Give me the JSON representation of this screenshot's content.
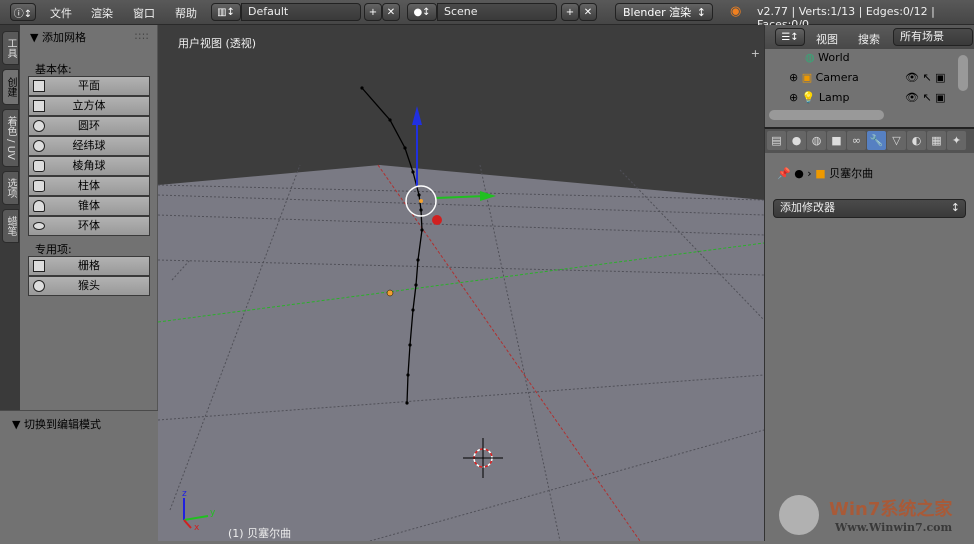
{
  "topbar": {
    "info_icon": "info-icon",
    "menus": [
      "文件",
      "渲染",
      "窗口",
      "帮助"
    ],
    "layout": "Default",
    "scene": "Scene",
    "engine": "Blender 渲染",
    "stats": "v2.77 | Verts:1/13 | Edges:0/12 | Faces:0/0"
  },
  "left_tabs": [
    "工具",
    "创建",
    "着色 / UV",
    "选项",
    "蜡笔"
  ],
  "tool_panel": {
    "title": "▼ 添加网格",
    "basic_label": "基本体:",
    "basic": [
      "平面",
      "立方体",
      "圆环",
      "经纬球",
      "棱角球",
      "柱体",
      "锥体",
      "环体"
    ],
    "special_label": "专用项:",
    "special": [
      "栅格",
      "猴头"
    ]
  },
  "redo_panel": {
    "title": "▼ 切换到编辑模式"
  },
  "viewport": {
    "title": "用户视图 (透视)",
    "object_label": "(1) 贝塞尔曲",
    "axes": {
      "x": "x",
      "y": "y",
      "z": "z"
    },
    "colors": {
      "x": "#d02020",
      "y": "#20c020",
      "z": "#2020e0"
    }
  },
  "outliner": {
    "view": "视图",
    "search": "搜索",
    "filter": "所有场景",
    "items": [
      "World",
      "Camera",
      "Lamp"
    ]
  },
  "properties": {
    "object_name": "贝塞尔曲",
    "add_modifier": "添加修改器"
  },
  "watermark": {
    "text": "Win7系统之家",
    "url": "Www.Winwin7.com"
  }
}
